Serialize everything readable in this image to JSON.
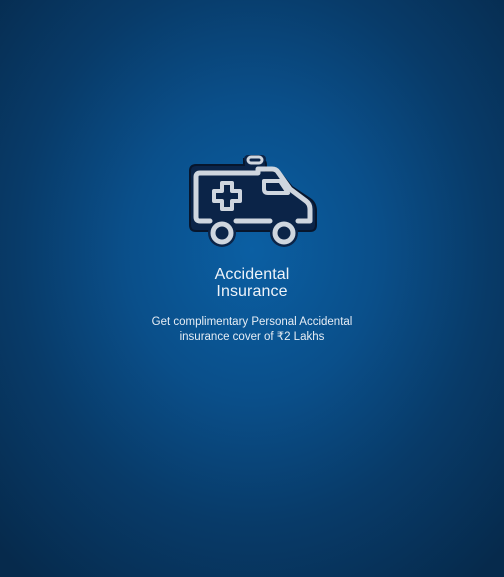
{
  "feature": {
    "icon": "ambulance-icon",
    "title_line1": "Accidental",
    "title_line2": "Insurance",
    "description_line1": "Get complimentary Personal Accidental",
    "description_line2": "insurance cover of ₹2 Lakhs"
  },
  "colors": {
    "background_center": "#0b5fa3",
    "background_edge": "#062a4c",
    "text": "#eef3f9",
    "icon_fill": "#0b2448",
    "icon_stroke": "#cfd6df"
  }
}
